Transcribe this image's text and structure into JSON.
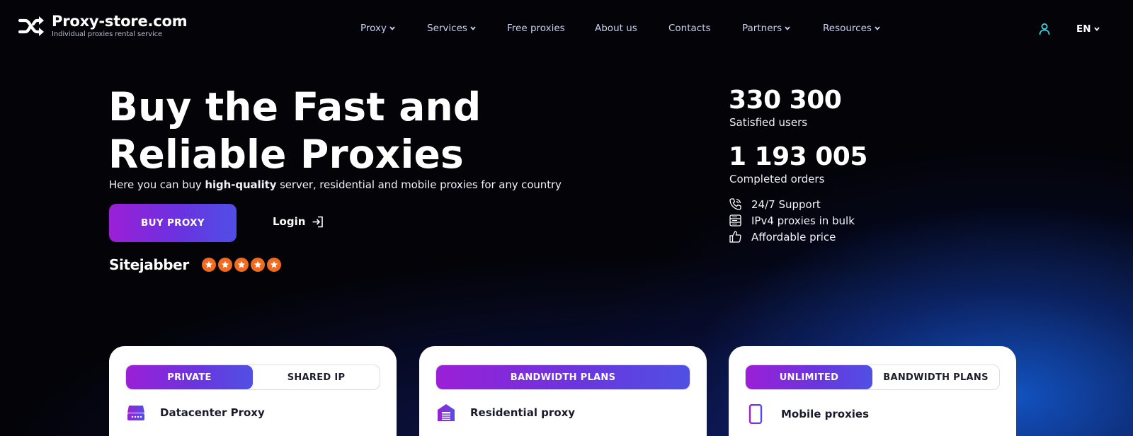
{
  "header": {
    "logo_title": "Proxy-store.com",
    "logo_subtitle": "Individual proxies rental service",
    "nav": [
      {
        "label": "Proxy",
        "dropdown": true
      },
      {
        "label": "Services",
        "dropdown": true
      },
      {
        "label": "Free proxies",
        "dropdown": false
      },
      {
        "label": "About us",
        "dropdown": false
      },
      {
        "label": "Contacts",
        "dropdown": false
      },
      {
        "label": "Partners",
        "dropdown": true
      },
      {
        "label": "Resources",
        "dropdown": true
      }
    ],
    "user_icon": "user-icon",
    "language": "EN"
  },
  "hero": {
    "title_line1": "Buy the Fast and",
    "title_line2": "Reliable Proxies",
    "subtitle_prefix": "Here you can buy ",
    "subtitle_bold": "high-quality",
    "subtitle_suffix": " server, residential and mobile proxies for any country",
    "buy_button": "BUY PROXY",
    "login_button": "Login",
    "rating_site": "Sitejabber",
    "rating_stars": 5
  },
  "stats": {
    "users_count": "330 300",
    "users_label": "Satisfied users",
    "orders_count": "1 193 005",
    "orders_label": "Completed orders",
    "features": [
      {
        "icon": "phone-icon",
        "label": "24/7 Support"
      },
      {
        "icon": "server-list-icon",
        "label": "IPv4 proxies in bulk"
      },
      {
        "icon": "thumbs-up-icon",
        "label": "Affordable price"
      }
    ]
  },
  "cards": [
    {
      "tabs": [
        "PRIVATE",
        "SHARED IP"
      ],
      "active_tab": "PRIVATE",
      "icon": "server-icon",
      "label": "Datacenter Proxy"
    },
    {
      "tabs": [
        "BANDWIDTH PLANS"
      ],
      "active_tab": "BANDWIDTH PLANS",
      "icon": "house-icon",
      "label": "Residential proxy"
    },
    {
      "tabs": [
        "UNLIMITED",
        "BANDWIDTH PLANS"
      ],
      "active_tab": "UNLIMITED",
      "icon": "phone-mobile-icon",
      "label": "Mobile proxies"
    }
  ],
  "colors": {
    "accent_start": "#9b1fd6",
    "accent_end": "#4f4fe6",
    "star": "#f06a20",
    "user_icon": "#3dd6e0",
    "background": "#030308"
  }
}
